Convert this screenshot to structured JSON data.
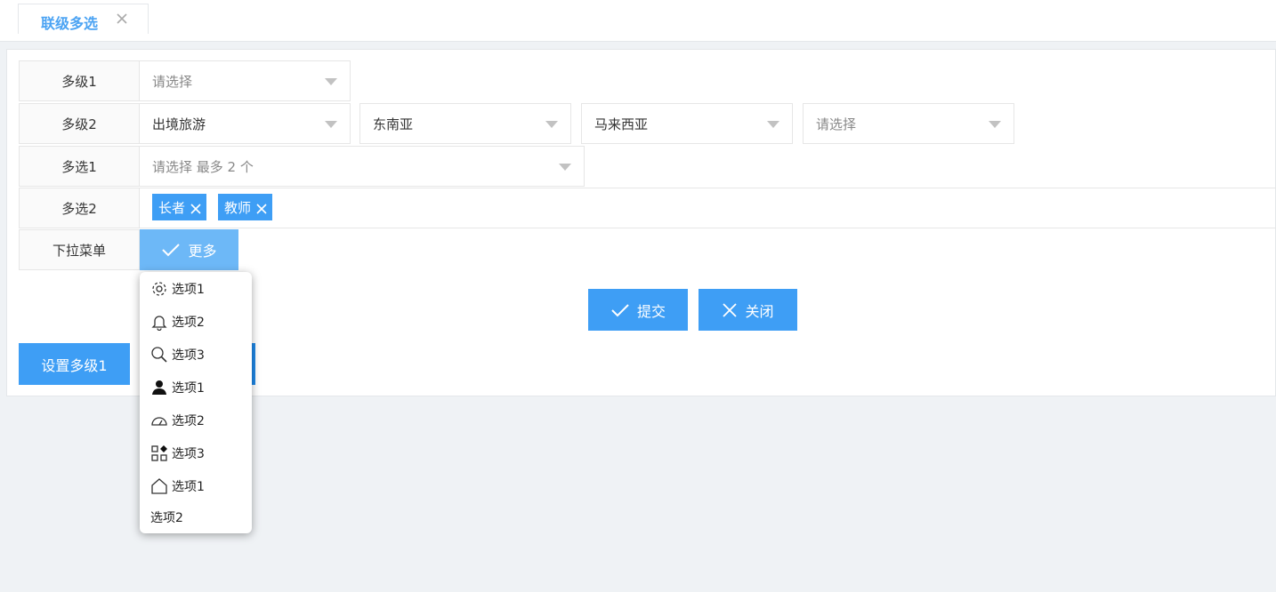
{
  "tabs": [
    {
      "label": "联级多选"
    }
  ],
  "form": {
    "rows": [
      {
        "label": "多级1",
        "selects": [
          {
            "value": "请选择",
            "placeholder": true
          }
        ]
      },
      {
        "label": "多级2",
        "selects": [
          {
            "value": "出境旅游"
          },
          {
            "value": "东南亚"
          },
          {
            "value": "马来西亚"
          },
          {
            "value": "请选择",
            "placeholder": true
          }
        ]
      },
      {
        "label": "多选1",
        "selects": [
          {
            "value": "请选择 最多 2 个",
            "placeholder": true
          }
        ]
      },
      {
        "label": "多选2",
        "tags": [
          "长者",
          "教师"
        ]
      },
      {
        "label": "下拉菜单",
        "dropdown_button": "更多"
      }
    ]
  },
  "actions": {
    "submit": "提交",
    "close": "关闭",
    "set_level1": "设置多级1"
  },
  "dropdown_menu": {
    "items": [
      {
        "icon": "gear-icon",
        "label": "选项1"
      },
      {
        "icon": "bell-icon",
        "label": "选项2"
      },
      {
        "icon": "search-icon",
        "label": "选项3"
      },
      {
        "icon": "user-icon",
        "label": "选项1"
      },
      {
        "icon": "dashboard-icon",
        "label": "选项2"
      },
      {
        "icon": "apps-icon",
        "label": "选项3"
      },
      {
        "icon": "home-icon",
        "label": "选项1"
      },
      {
        "icon": "",
        "label": "选项2"
      }
    ]
  },
  "colors": {
    "primary": "#3e9ef5",
    "primary_light": "#6db8f7",
    "tab_active": "#4ba3f3"
  }
}
